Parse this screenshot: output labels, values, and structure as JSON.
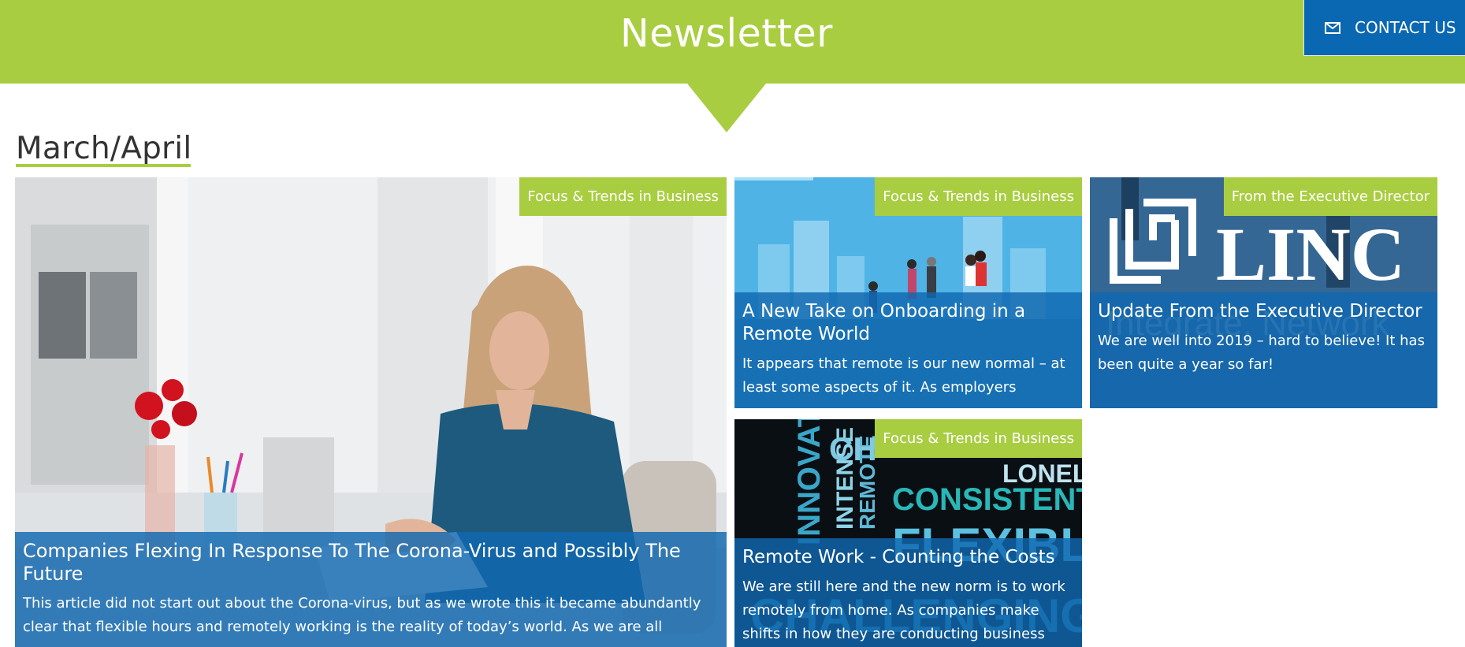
{
  "header": {
    "title": "Newsletter",
    "contact_label": "CONTACT US",
    "contact_icon": "envelope-icon"
  },
  "section": {
    "title": "March/April"
  },
  "colors": {
    "accent_green": "#a9cd41",
    "brand_blue": "#0a67b1"
  },
  "articles": [
    {
      "category": "Focus & Trends in Business",
      "title": "Companies Flexing In Response To The Corona-Virus and Possibly The Future",
      "excerpt": "This article did not start out about the Corona-virus, but as we wrote this it became abundantly clear that flexible hours and remotely working is the reality of today’s world. As we are all"
    },
    {
      "category": "Focus & Trends in Business",
      "title": "A New Take on Onboarding in a Remote World",
      "excerpt": "It appears that remote is our new normal – at least some aspects of it. As employers"
    },
    {
      "category": "From the Executive Director",
      "title": "Update From the Executive Director",
      "excerpt": "We are well into 2019 – hard to believe!  It has been quite a year so far!"
    },
    {
      "category": "Focus & Trends in Business",
      "title": "Remote Work - Counting the Costs",
      "excerpt": "We are still here and the new norm is to work remotely from home. As companies make shifts in how they are conducting business"
    }
  ],
  "image_text": {
    "linc_logo": "LINC",
    "linc_tagline": "Integrate, Network",
    "word_cloud": [
      "INNOVATIVE",
      "CHALLENGING",
      "CONSISTENT",
      "LONELY",
      "FLEXIBLE",
      "INTENSE",
      "REMOTE"
    ]
  }
}
